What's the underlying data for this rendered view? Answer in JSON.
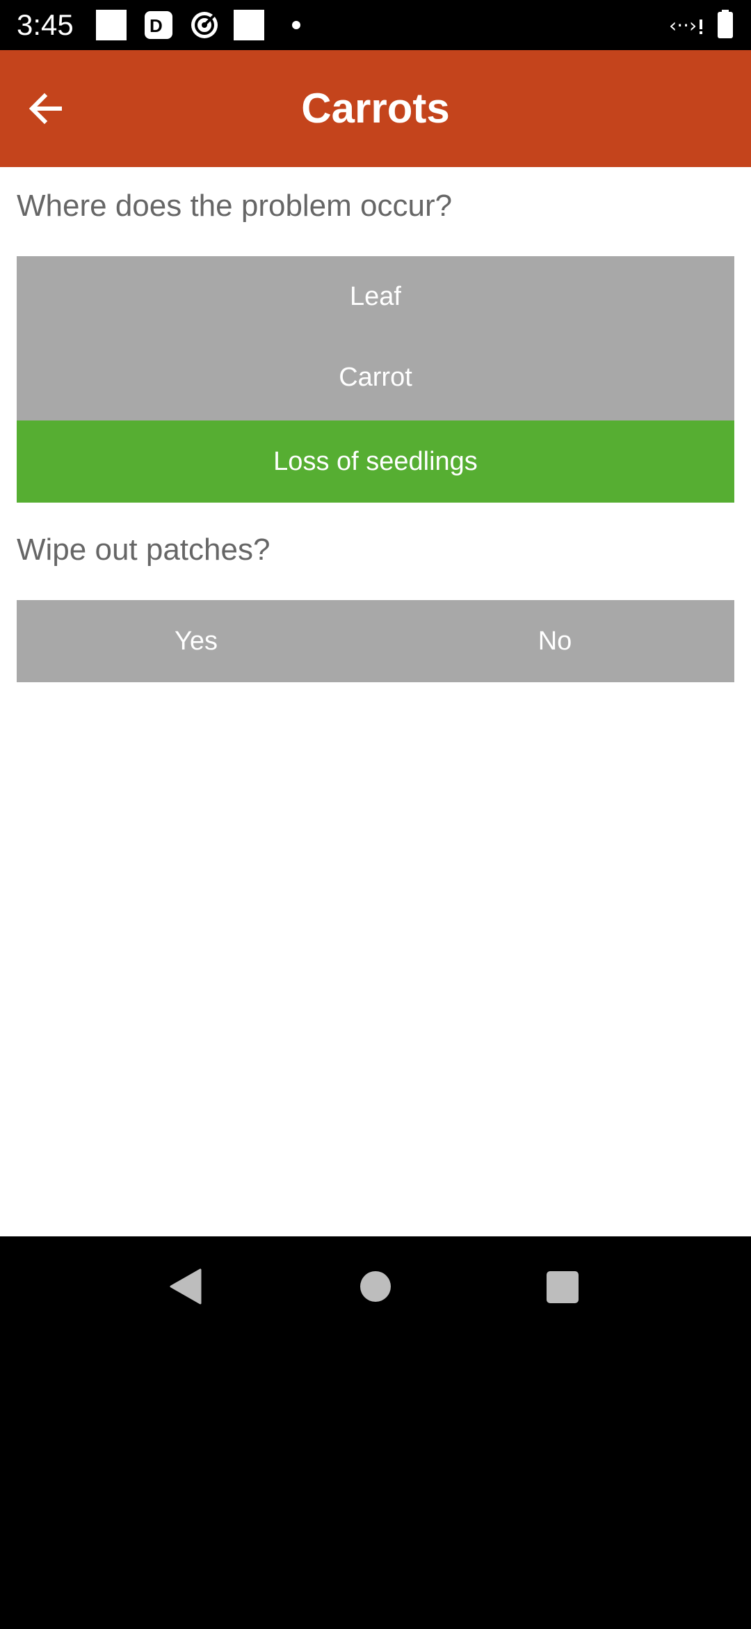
{
  "status_bar": {
    "time": "3:45",
    "icons": [
      "notification-square-icon",
      "d-app-icon",
      "target-app-icon",
      "notification-square-icon",
      "more-dot-icon",
      "signal-icon",
      "battery-icon"
    ]
  },
  "app_bar": {
    "title": "Carrots",
    "back_icon": "arrow-back-icon",
    "color": "#c4441c"
  },
  "questions": [
    {
      "text": "Where does the problem occur?",
      "options": [
        {
          "label": "Leaf",
          "selected": false
        },
        {
          "label": "Carrot",
          "selected": false
        },
        {
          "label": "Loss of seedlings",
          "selected": true
        }
      ]
    },
    {
      "text": "Wipe out patches?",
      "options": [
        {
          "label": "Yes",
          "selected": false
        },
        {
          "label": "No",
          "selected": false
        }
      ]
    }
  ],
  "colors": {
    "option_default": "#a8a8a8",
    "option_selected": "#56ae32",
    "question_text": "#666666"
  },
  "nav_bar": {
    "icons": [
      "nav-back-icon",
      "nav-home-icon",
      "nav-recents-icon"
    ]
  }
}
